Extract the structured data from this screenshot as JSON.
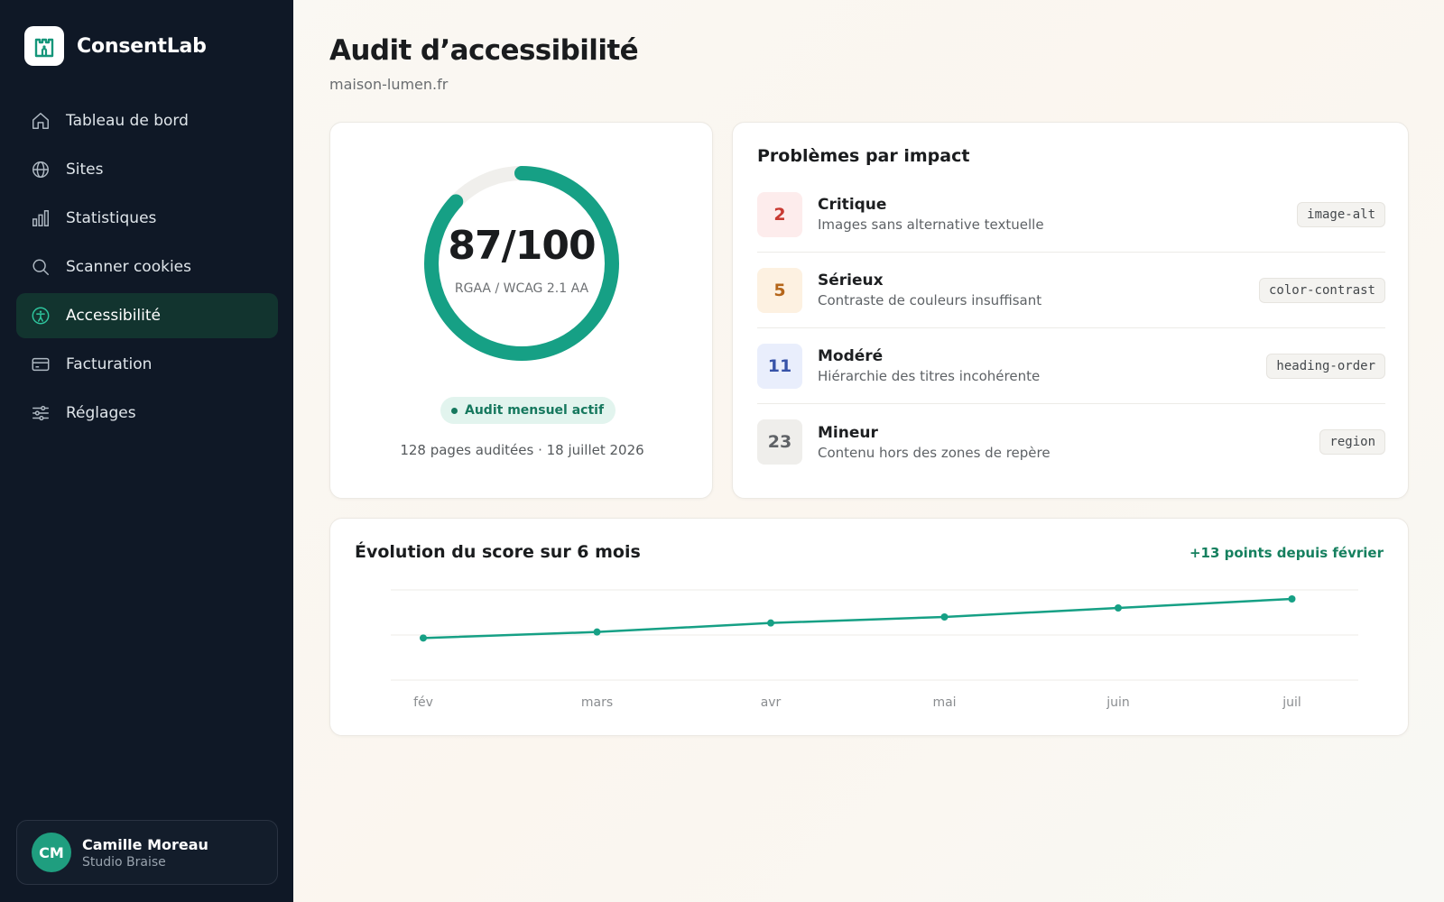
{
  "brand": {
    "name": "ConsentLab"
  },
  "sidebar": {
    "items": [
      {
        "label": "Tableau de bord",
        "icon": "home-icon"
      },
      {
        "label": "Sites",
        "icon": "globe-icon"
      },
      {
        "label": "Statistiques",
        "icon": "bar-chart-icon"
      },
      {
        "label": "Scanner cookies",
        "icon": "search-icon"
      },
      {
        "label": "Accessibilité",
        "icon": "accessibility-icon",
        "active": true
      },
      {
        "label": "Facturation",
        "icon": "credit-card-icon"
      },
      {
        "label": "Réglages",
        "icon": "sliders-icon"
      }
    ]
  },
  "user": {
    "initials": "CM",
    "name": "Camille Moreau",
    "org": "Studio Braise"
  },
  "page": {
    "title": "Audit d’accessibilité",
    "subtitle": "maison-lumen.fr"
  },
  "score": {
    "value": "87/100",
    "score_fraction": 0.87,
    "standard": "RGAA / WCAG 2.1 AA",
    "badge": "Audit mensuel actif",
    "meta": "128 pages auditées · 18 juillet 2026"
  },
  "issues": {
    "title": "Problèmes par impact",
    "rows": [
      {
        "count": "2",
        "label": "Critique",
        "desc": "Images sans alternative textuelle",
        "code": "image-alt",
        "bg": "#fdecec",
        "fg": "#c83a32"
      },
      {
        "count": "5",
        "label": "Sérieux",
        "desc": "Contraste de couleurs insuffisant",
        "code": "color-contrast",
        "bg": "#fdf1e1",
        "fg": "#b5661a"
      },
      {
        "count": "11",
        "label": "Modéré",
        "desc": "Hiérarchie des titres incohérente",
        "code": "heading-order",
        "bg": "#e9eefc",
        "fg": "#3753a8"
      },
      {
        "count": "23",
        "label": "Mineur",
        "desc": "Contenu hors des zones de repère",
        "code": "region",
        "bg": "#efeeeb",
        "fg": "#5f6266"
      }
    ]
  },
  "trend": {
    "title": "Évolution du score sur 6 mois",
    "delta": "+13 points depuis février"
  },
  "colors": {
    "accent": "#16a085",
    "sidebar_bg": "#0f1826",
    "active_bg": "#12342f"
  },
  "chart_data": {
    "type": "line",
    "categories": [
      "fév",
      "mars",
      "avr",
      "mai",
      "juin",
      "juil"
    ],
    "series": [
      {
        "values": [
          74,
          76,
          79,
          81,
          84,
          87
        ]
      }
    ],
    "ylim": [
      60,
      90
    ],
    "grid": true
  }
}
